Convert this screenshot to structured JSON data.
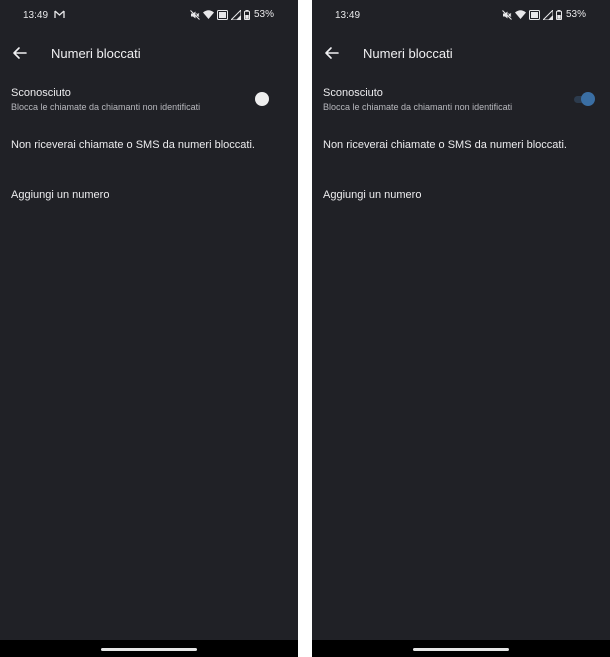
{
  "screens": [
    {
      "status_bar": {
        "time": "13:49",
        "battery": "53%",
        "icons": [
          "gmail-icon",
          "mute-icon",
          "wifi-icon",
          "volte-icon",
          "signal-icon",
          "battery-icon"
        ]
      },
      "toolbar": {
        "title": "Numeri bloccati",
        "back_icon": "arrow-left-icon"
      },
      "unknown": {
        "title": "Sconosciuto",
        "subtitle": "Blocca le chiamate da chiamanti non identificati",
        "toggle_on": false
      },
      "info": "Non riceverai chiamate o SMS da numeri bloccati.",
      "add_number": "Aggiungi un numero"
    },
    {
      "status_bar": {
        "time": "13:49",
        "battery": "53%",
        "icons": [
          "mute-icon",
          "wifi-icon",
          "volte-icon",
          "signal-icon",
          "battery-icon"
        ]
      },
      "toolbar": {
        "title": "Numeri bloccati",
        "back_icon": "arrow-left-icon"
      },
      "unknown": {
        "title": "Sconosciuto",
        "subtitle": "Blocca le chiamate da chiamanti non identificati",
        "toggle_on": true
      },
      "info": "Non riceverai chiamate o SMS da numeri bloccati.",
      "add_number": "Aggiungi un numero"
    }
  ],
  "colors": {
    "background": "#202126",
    "text": "#e8e8ea",
    "subtext": "#b7b8bd",
    "toggle_on": "#3a6ea3",
    "toggle_off": "#eeeeee",
    "nav_bar": "#000000"
  }
}
